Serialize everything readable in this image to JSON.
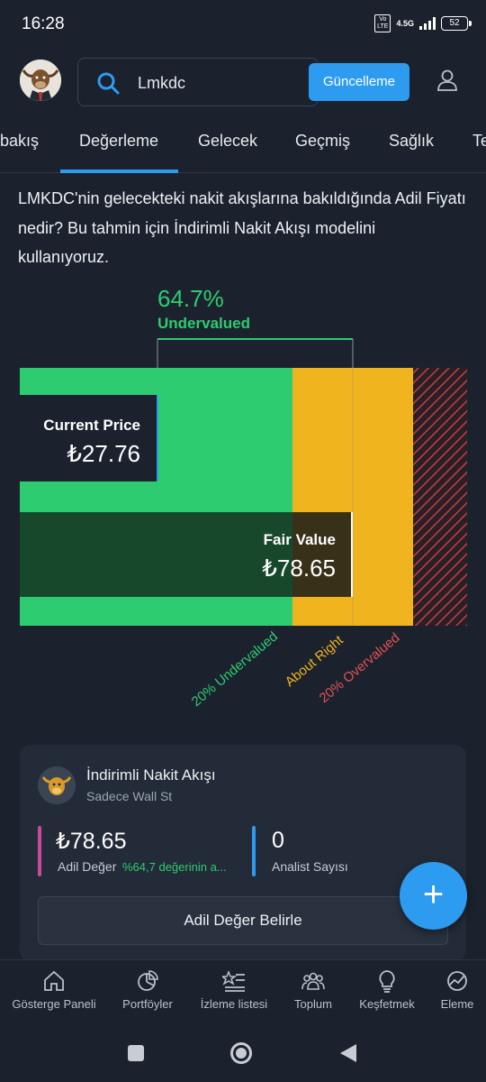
{
  "status_bar": {
    "time": "16:28",
    "volte": "Vo LTE",
    "network": "4.5G",
    "battery": "52"
  },
  "header": {
    "search_text": "Lmkdc",
    "update_button": "Güncelleme"
  },
  "tabs": [
    {
      "label": "bakış"
    },
    {
      "label": "Değerleme",
      "active": true
    },
    {
      "label": "Gelecek"
    },
    {
      "label": "Geçmiş"
    },
    {
      "label": "Sağlık"
    },
    {
      "label": "Te"
    }
  ],
  "description": "LMKDC'nin gelecekteki nakit akışlarına bakıldığında Adil Fiyatı nedir? Bu tahmin için İndirimli Nakit Akışı modelini kullanıyoruz.",
  "valuation": {
    "discount_percent": "64.7%",
    "discount_label": "Undervalued",
    "current_price_label": "Current Price",
    "current_price": "₺27.76",
    "fair_value_label": "Fair Value",
    "fair_value": "₺78.65",
    "zone_labels": [
      "20% Undervalued",
      "About Right",
      "20% Overvalued"
    ],
    "colors": {
      "undervalued": "#2ecc71",
      "about_right": "#f0b41e",
      "overvalued": "#e05353"
    }
  },
  "chart_data": {
    "type": "bar",
    "categories": [
      "Current Price",
      "Fair Value"
    ],
    "values": [
      27.76,
      78.65
    ],
    "unit": "₺",
    "discount_pct": 64.7
  },
  "card": {
    "title": "İndirimli Nakit Akışı",
    "subtitle": "Sadece Wall St",
    "fair_value": "₺78.65",
    "fair_value_label": "Adil Değer",
    "fair_value_note": "%64,7 değerinin a...",
    "analyst_count": "0",
    "analyst_label": "Analist Sayısı",
    "button": "Adil Değer Belirle"
  },
  "bottom_nav": [
    {
      "label": "Gösterge Paneli",
      "icon": "home-icon"
    },
    {
      "label": "Portföyler",
      "icon": "pie-chart-icon"
    },
    {
      "label": "İzleme listesi",
      "icon": "star-list-icon"
    },
    {
      "label": "Toplum",
      "icon": "community-icon"
    },
    {
      "label": "Keşfetmek",
      "icon": "lightbulb-icon"
    },
    {
      "label": "Eleme",
      "icon": "screener-icon"
    }
  ]
}
